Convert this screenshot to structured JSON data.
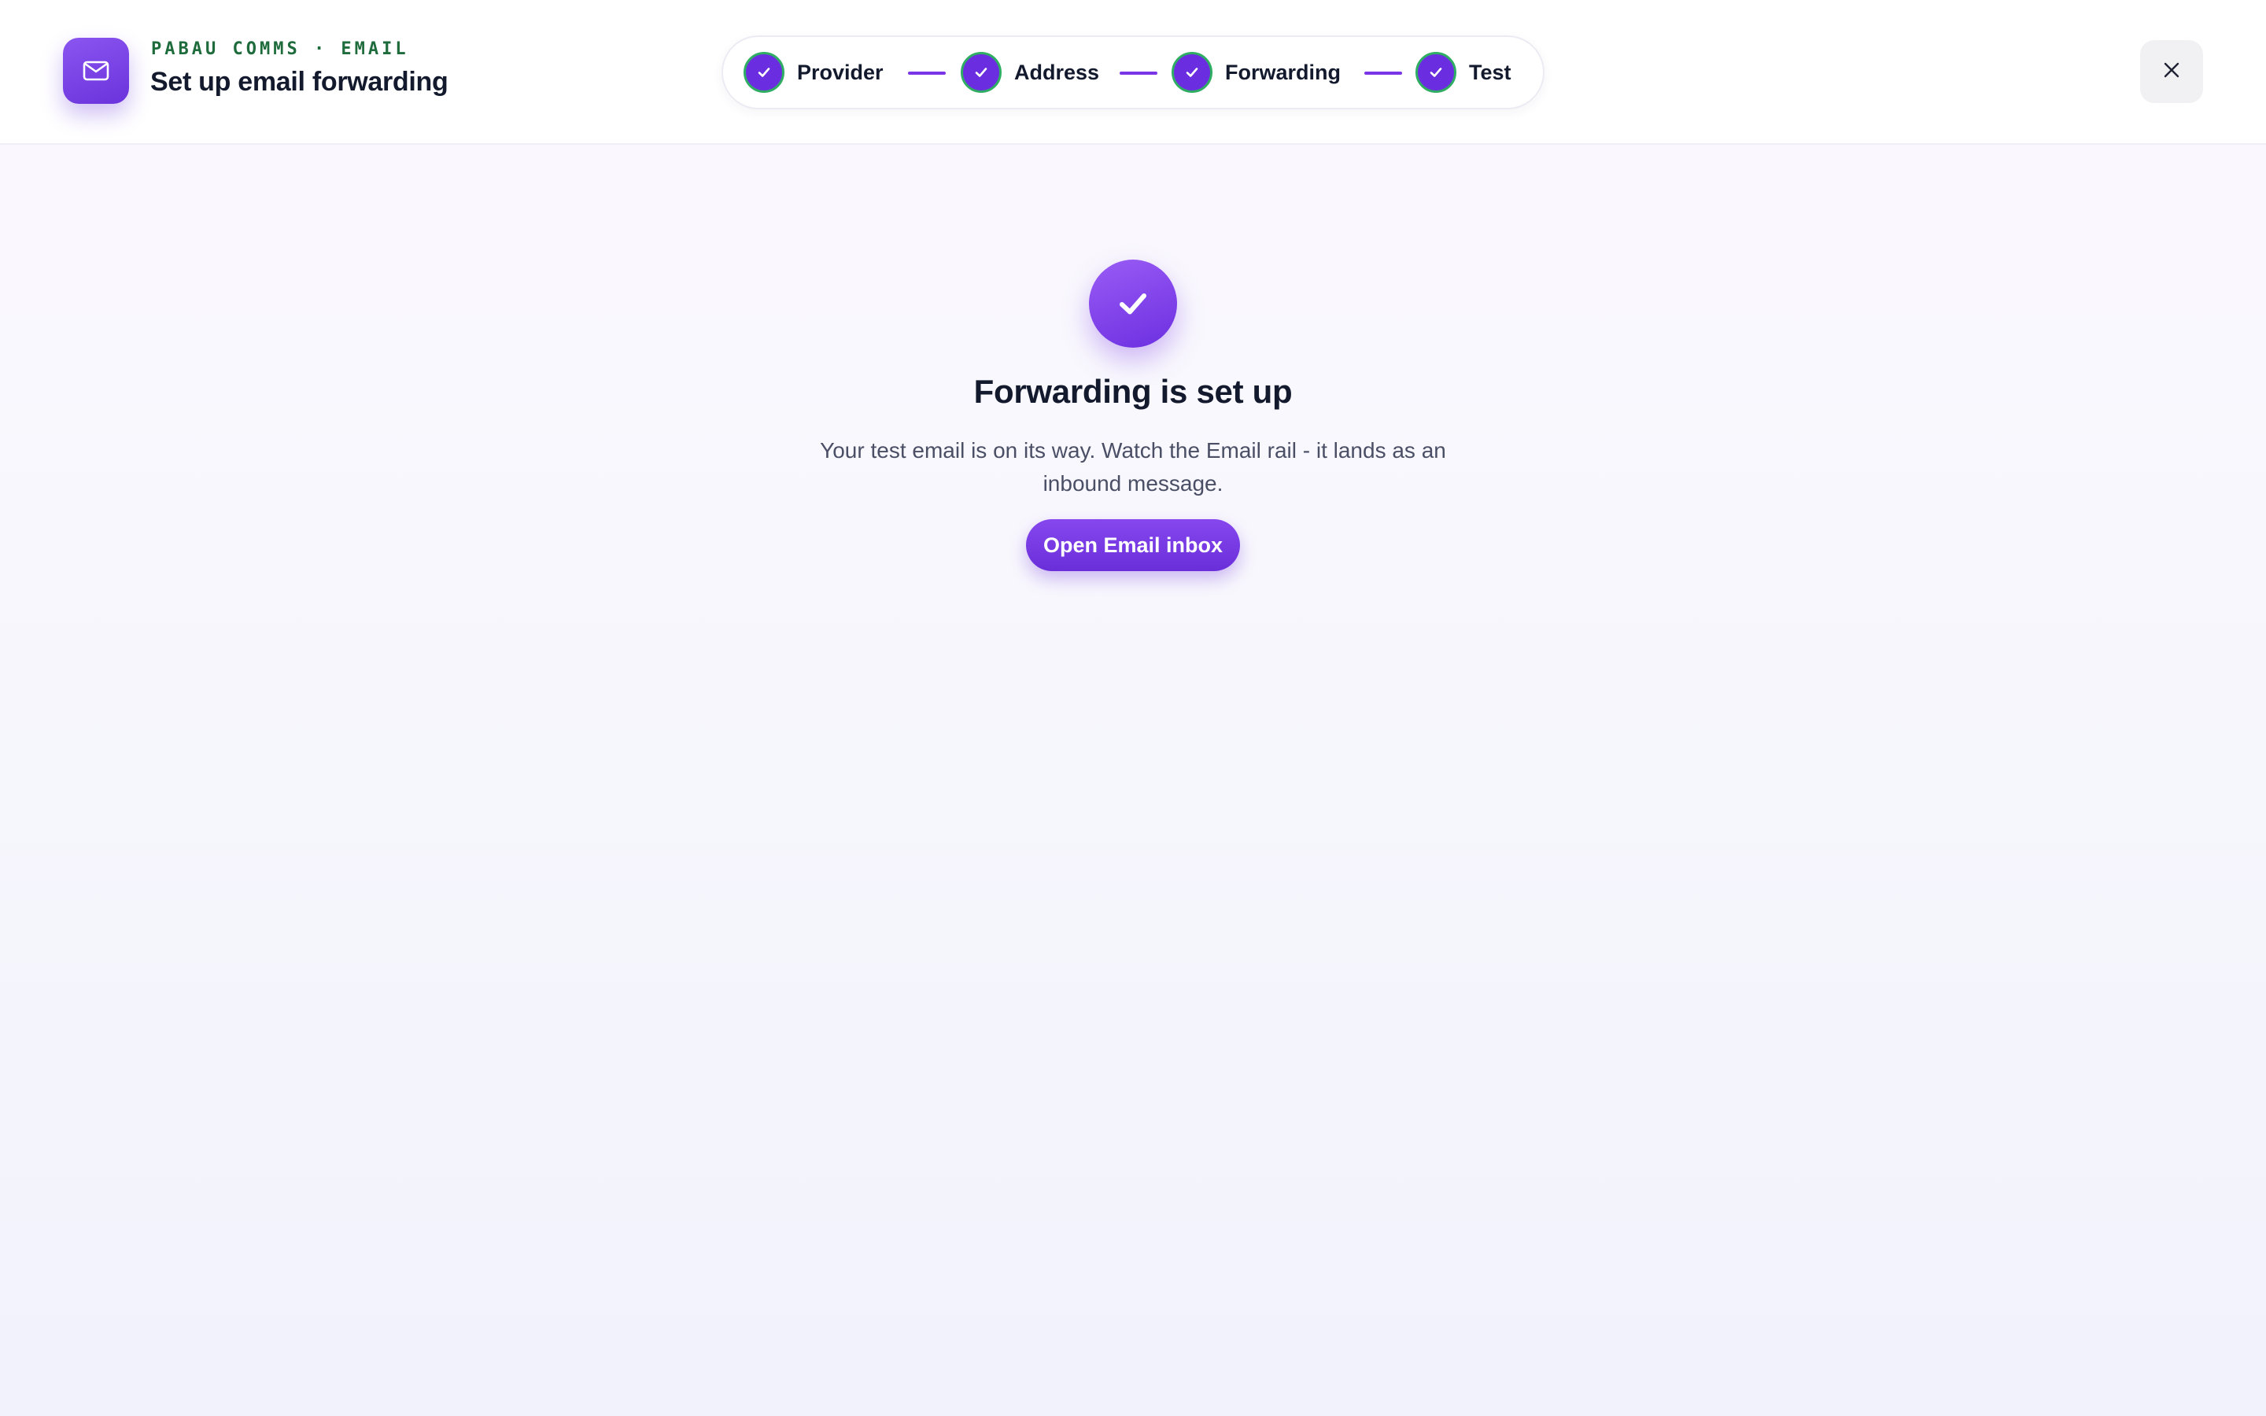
{
  "header": {
    "kicker": "PABAU COMMS · EMAIL",
    "title": "Set up email forwarding",
    "app_icon": "mail-icon",
    "close_icon": "close-icon"
  },
  "stepper": {
    "steps": [
      {
        "label": "Provider",
        "status": "complete",
        "icon": "check-icon"
      },
      {
        "label": "Address",
        "status": "complete",
        "icon": "check-icon"
      },
      {
        "label": "Forwarding",
        "status": "complete",
        "icon": "check-icon"
      },
      {
        "label": "Test",
        "status": "complete",
        "icon": "check-icon"
      }
    ]
  },
  "main": {
    "icon": "check-icon",
    "title": "Forwarding is set up",
    "body": "Your test email is on its way. Watch the Email rail - it lands as an inbound message.",
    "button_label": "Open Email inbox"
  },
  "colors": {
    "accent": "#6a2ee0",
    "step_ring": "#2fae63",
    "kicker": "#1e6b3c",
    "text": "#141a2e"
  }
}
